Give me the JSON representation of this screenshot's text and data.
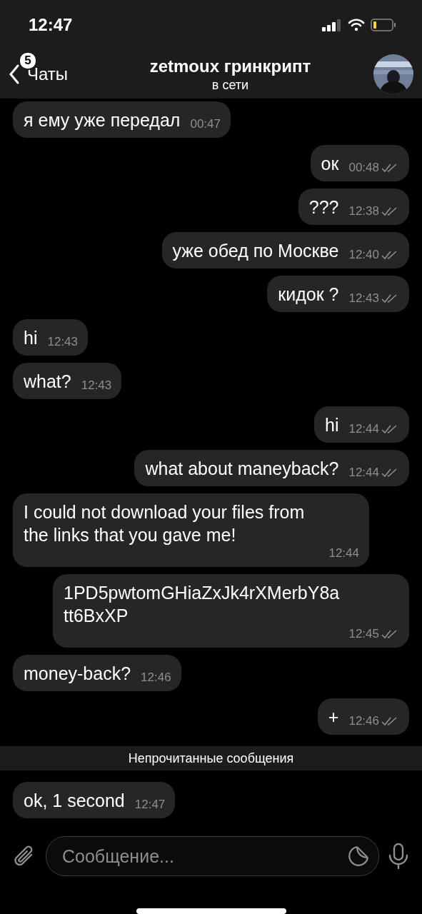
{
  "status_bar": {
    "time": "12:47"
  },
  "header": {
    "back_label": "Чаты",
    "unread_badge": "5",
    "title": "zetmoux гринкрипт",
    "subtitle": "в сети"
  },
  "messages": [
    {
      "kind": "incoming",
      "text": "я ему уже передал",
      "time": "00:47"
    },
    {
      "kind": "outgoing",
      "text": "ок",
      "time": "00:48",
      "read": true
    },
    {
      "kind": "outgoing",
      "text": "???",
      "time": "12:38",
      "read": true
    },
    {
      "kind": "outgoing",
      "text": "уже обед по Москве",
      "time": "12:40",
      "read": true
    },
    {
      "kind": "outgoing",
      "text": "кидок ?",
      "time": "12:43",
      "read": true
    },
    {
      "kind": "incoming",
      "text": "hi",
      "time": "12:43"
    },
    {
      "kind": "incoming",
      "text": "what?",
      "time": "12:43"
    },
    {
      "kind": "outgoing",
      "text": "hi",
      "time": "12:44",
      "read": true
    },
    {
      "kind": "outgoing",
      "text": "what about maneyback?",
      "time": "12:44",
      "read": true
    },
    {
      "kind": "incoming",
      "text": "I could not download your files from the links that you gave me!",
      "time": "12:44"
    },
    {
      "kind": "outgoing",
      "text": "1PD5pwtomGHiaZxJk4rXMerbY8att6BxXP",
      "time": "12:45",
      "read": true
    },
    {
      "kind": "incoming",
      "text": "money-back?",
      "time": "12:46"
    },
    {
      "kind": "outgoing",
      "text": "+",
      "time": "12:46",
      "read": true
    },
    {
      "kind": "divider",
      "text": "Непрочитанные сообщения"
    },
    {
      "kind": "incoming",
      "text": "ok, 1 second",
      "time": "12:47"
    }
  ],
  "composer": {
    "placeholder": "Сообщение..."
  }
}
